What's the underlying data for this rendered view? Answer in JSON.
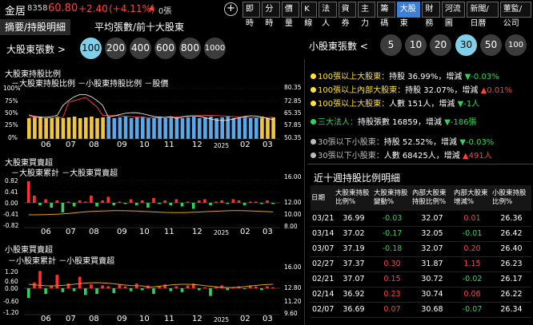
{
  "header": {
    "stock_name": "金居",
    "stock_code": "8358",
    "price": "60.80",
    "change": "+2.40",
    "pct_change": "(+4.11%)",
    "arrow": "▲",
    "volume": "0張",
    "plus": "+",
    "nav": [
      "即時",
      "分時",
      "價量",
      "K線",
      "法人",
      "資券",
      "主力",
      "籌碼",
      "大股東",
      "財務",
      "河流圖",
      "新聞/日曆",
      "董監/公司"
    ],
    "active_nav": "大股東"
  },
  "subtabs": [
    "摘要/持股明細",
    "平均張數/前十大股東"
  ],
  "big_selector": {
    "label": "大股東張數 >",
    "options": [
      "100",
      "200",
      "400",
      "600",
      "800",
      "1000"
    ],
    "active": "100"
  },
  "small_selector": {
    "label": "小股東張數 <",
    "options": [
      "5",
      "10",
      "20",
      "30",
      "50",
      "100"
    ],
    "active": "30"
  },
  "chart1": {
    "title": "大股東持股比例",
    "legend": "－大股東持股比例 －小股東持股比例 －股價",
    "left_ticks": [
      "100%",
      "75%",
      "50%",
      "25%",
      "0%"
    ],
    "right_ticks": [
      "80.35",
      "72.85",
      "65.35",
      "57.85",
      "50.35"
    ],
    "x_ticks": [
      "06",
      "07",
      "08",
      "09",
      "10",
      "11",
      "12",
      "2025",
      "02",
      "03"
    ]
  },
  "chart2": {
    "title": "大股東買賣超",
    "legend": "－大股東累計 －大股東買賣超",
    "left_ticks": [
      "0.82",
      "0.41",
      "0.00",
      "-0.41",
      "-0.82"
    ],
    "right_ticks": [
      "16.00",
      "12.00",
      "10.00",
      "8.00"
    ],
    "x_ticks": [
      "06",
      "07",
      "08",
      "09",
      "10",
      "11",
      "12",
      "2025",
      "02",
      "03"
    ]
  },
  "chart3": {
    "title": "小股東買賣超",
    "legend": "－小股東累計 －小股東買賣超",
    "left_ticks": [
      "1.20",
      "0.60",
      "0.00",
      "-0.60",
      "-1.20"
    ],
    "right_ticks": [
      "16.00",
      "12.80",
      "11.20",
      "9.60"
    ],
    "x_ticks": [
      "06",
      "07",
      "08",
      "09",
      "10",
      "11",
      "12",
      "2025",
      "02",
      "03"
    ]
  },
  "summary": {
    "big100": {
      "label": "100張以上大股東：",
      "text": "持股 36.99%，增減 ",
      "arrow": "▼",
      "value": "-0.03%"
    },
    "insider": {
      "label": "100張以上內部大股東：",
      "text": "持股 32.07%，增減 ",
      "arrow": "▲",
      "value": "0.01%"
    },
    "big100_people": {
      "label": "100張以上大股東：",
      "text": "人數 151人，增減 ",
      "arrow": "▼",
      "value": "-1人"
    },
    "institutions": {
      "label": "三大法人：",
      "text": "持股張數 16859，增減 ",
      "arrow": "▼",
      "value": "-186張"
    },
    "small30": {
      "label": "30張以下小股東：",
      "text": "持股 52.52%，增減 ",
      "arrow": "▼",
      "value": "-0.03%"
    },
    "small30_people": {
      "label": "30張以下小股東：",
      "text": "人數 68425人，增減 ",
      "arrow": "▲",
      "value": "491人"
    },
    "colors": {
      "yellow": "#ffe23a",
      "green": "#2fd35c",
      "grey": "#bbbbbb",
      "red": "#ff4040"
    }
  },
  "table": {
    "title": "近十週持股比例明細",
    "headers": [
      "日期",
      "大股東持股比例%",
      "大股東持股變動%",
      "內部大股東持股比例%",
      "內部大股東增減%",
      "小股東持股比例%"
    ],
    "rows": [
      [
        "03/21",
        "36.99",
        "-0.03",
        "32.07",
        "0.01",
        "26.36"
      ],
      [
        "03/14",
        "37.02",
        "-0.17",
        "32.05",
        "-0.01",
        "26.42"
      ],
      [
        "03/07",
        "37.19",
        "-0.18",
        "32.07",
        "0.20",
        "26.40"
      ],
      [
        "02/27",
        "37.37",
        "0.30",
        "31.87",
        "1.15",
        "26.23"
      ],
      [
        "02/21",
        "37.07",
        "0.15",
        "30.72",
        "-0.02",
        "26.17"
      ],
      [
        "02/14",
        "36.92",
        "0.23",
        "30.74",
        "0.06",
        "26.22"
      ],
      [
        "02/07",
        "36.69",
        "0.07",
        "30.68",
        "-0.07",
        "26.34"
      ]
    ]
  }
}
